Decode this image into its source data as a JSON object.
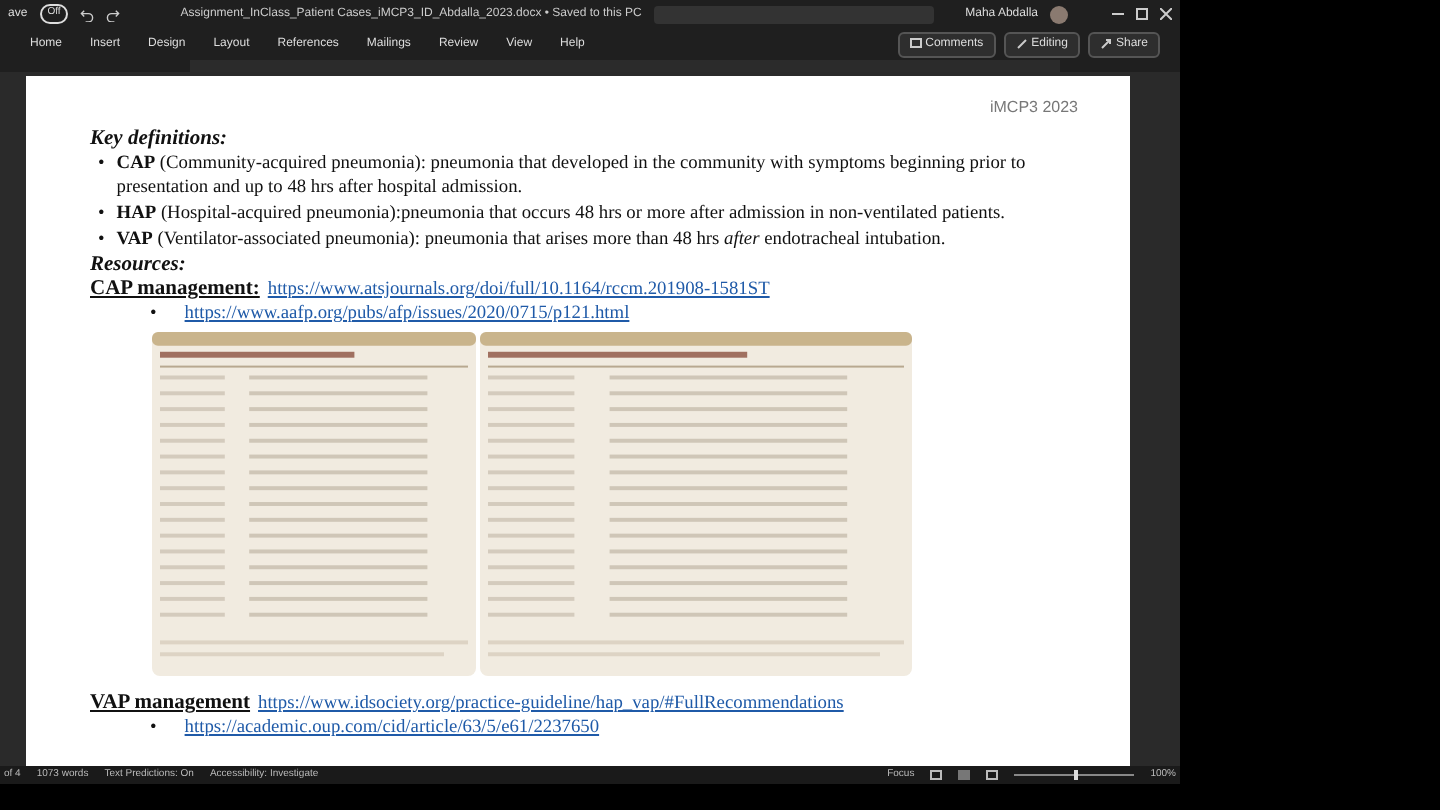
{
  "title_bar": {
    "autosave_label": "ave",
    "autosave_state": "Off",
    "autosave_on": false,
    "file_title": "Assignment_InClass_Patient Cases_iMCP3_ID_Abdalla_2023.docx • Saved to this PC",
    "user": "Maha Abdalla"
  },
  "ribbon": {
    "tabs": [
      {
        "label": "Home",
        "selected": false
      },
      {
        "label": "Insert",
        "selected": false
      },
      {
        "label": "Design",
        "selected": false
      },
      {
        "label": "Layout",
        "selected": false
      },
      {
        "label": "References",
        "selected": false
      },
      {
        "label": "Mailings",
        "selected": false
      },
      {
        "label": "Review",
        "selected": false
      },
      {
        "label": "View",
        "selected": false
      },
      {
        "label": "Help",
        "selected": false
      }
    ],
    "buttons": [
      {
        "kind": "comments",
        "label": "Comments"
      },
      {
        "kind": "editing",
        "label": "Editing"
      },
      {
        "kind": "share",
        "label": "Share"
      }
    ]
  },
  "document": {
    "header": "iMCP3 2023",
    "heading": "Key definitions:",
    "definitions": [
      {
        "marker": "•",
        "text": "**CAP** (Community-acquired pneumonia): pneumonia that developed in the community with symptoms beginning prior to presentation and up to 48 hrs after hospital admission."
      },
      {
        "marker": "•",
        "text": "**HAP** (Hospital-acquired pneumonia):pneumonia that occurs 48 hrs or more after admission in non-ventilated patients."
      },
      {
        "marker": "•",
        "text": "**VAP** (Ventilator-associated pneumonia): pneumonia that arises more than 48 hrs *after* endotracheal intubation."
      }
    ],
    "resources_heading": "Resources:",
    "sections": [
      {
        "title": "CAP management:",
        "link": "https://www.atsjournals.org/doi/full/10.1164/rccm.201908-1581ST",
        "bullets": [
          {
            "marker": "•",
            "link": "https://www.aafp.org/pubs/afp/issues/2020/0715/p121.html"
          }
        ],
        "figures": [
          {
            "kind": "picture"
          },
          {
            "kind": "picture"
          }
        ]
      },
      {
        "title": "VAP management",
        "link": "https://www.idsociety.org/practice-guideline/hap_vap/#FullRecommendations",
        "bullets": [
          {
            "marker": "•",
            "link": "https://academic.oup.com/cid/article/63/5/e61/2237650"
          }
        ]
      }
    ]
  },
  "status_bar": {
    "page": "of 4",
    "words": "1073 words",
    "predictions": "Text Predictions: On",
    "accessibility": "Accessibility: Investigate",
    "focus": "Focus",
    "zoom": "100%",
    "level": 0.5
  }
}
